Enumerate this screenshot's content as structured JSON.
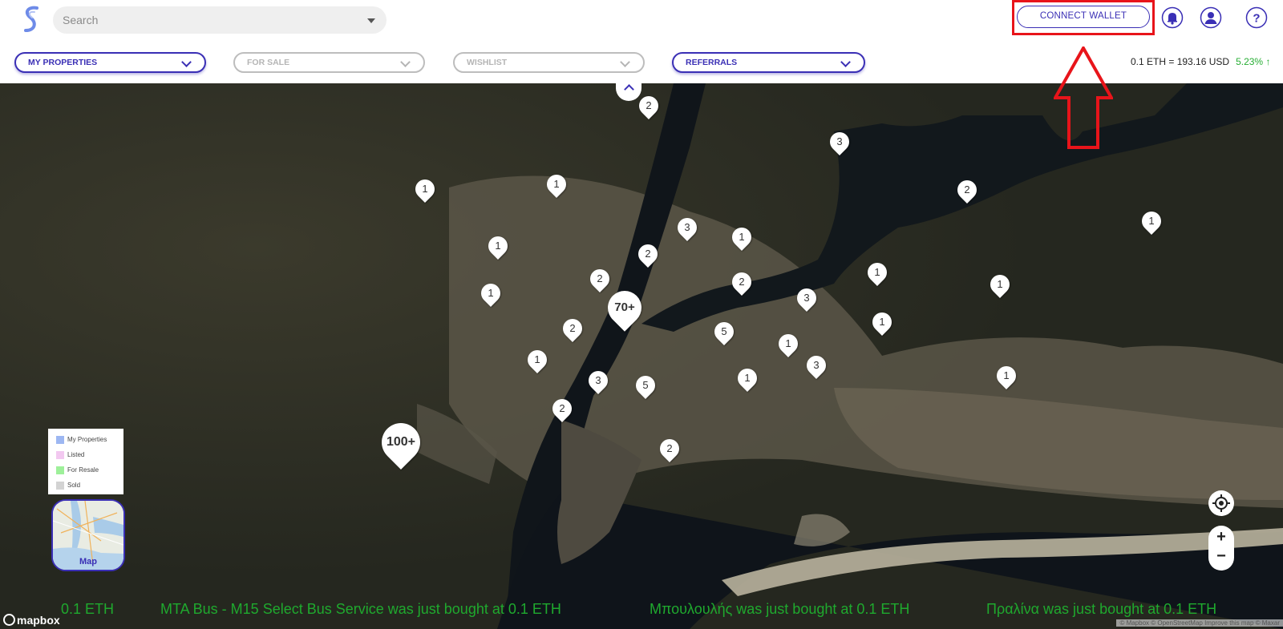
{
  "header": {
    "search_placeholder": "Search",
    "connect_wallet": "CONNECT WALLET"
  },
  "icons": [
    "bell-icon",
    "user-icon",
    "help-icon"
  ],
  "filters": [
    {
      "label": "MY PROPERTIES",
      "state": "active"
    },
    {
      "label": "FOR SALE",
      "state": "inactive"
    },
    {
      "label": "WISHLIST",
      "state": "inactive"
    },
    {
      "label": "REFERRALS",
      "state": "active"
    }
  ],
  "rate": {
    "text": "0.1 ETH = 193.16 USD",
    "change": "5.23% ↑"
  },
  "markers": [
    "2",
    "3",
    "1",
    "1",
    "2",
    "1",
    "1",
    "3",
    "1",
    "2",
    "2",
    "1",
    "1",
    "2",
    "3",
    "1",
    "2",
    "5",
    "1",
    "1",
    "3",
    "1",
    "1",
    "3",
    "5",
    "2",
    "1",
    "2",
    "100+",
    "70+"
  ],
  "legend": [
    {
      "label": "My Properties",
      "color": "#9db7f2"
    },
    {
      "label": "Listed",
      "color": "#f2c8f0"
    },
    {
      "label": "For Resale",
      "color": "#9ef09a"
    },
    {
      "label": "Sold",
      "color": "#d3d3d3"
    }
  ],
  "minimap_label": "Map",
  "zoom": {
    "in": "+",
    "out": "−"
  },
  "ticker": [
    "0.1 ETH",
    "MTA Bus - M15 Select Bus Service was just bought at 0.1 ETH",
    "Μπουλουλής was just bought at 0.1 ETH",
    "Πραλίνα was just bought at 0.1 ETH"
  ],
  "mapbox_label": "mapbox",
  "attribution": "© Mapbox © OpenStreetMap Improve this map © Maxar",
  "colors": {
    "accent": "#3a2fb5",
    "highlight": "#e8141a",
    "ticker": "#1fa92e"
  }
}
